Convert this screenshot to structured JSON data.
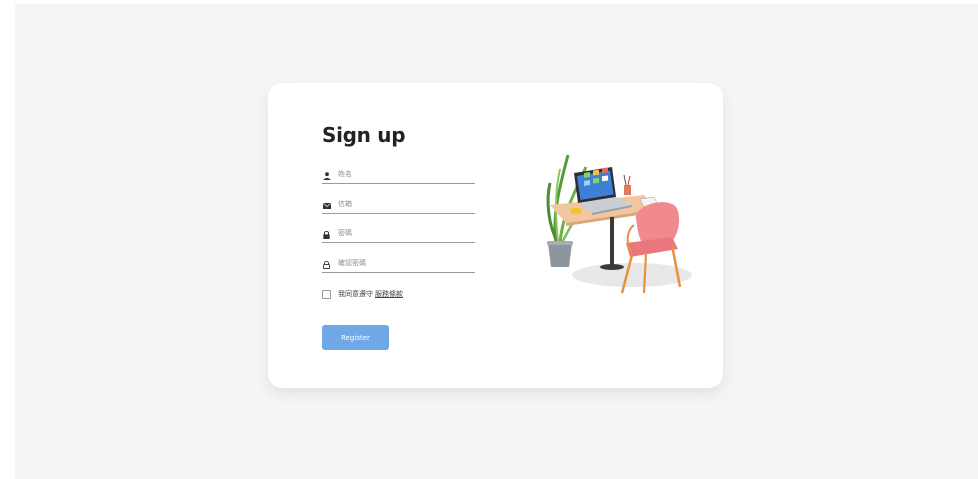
{
  "form": {
    "title": "Sign up",
    "name_placeholder": "姓名",
    "email_placeholder": "信箱",
    "password_placeholder": "密碼",
    "confirm_placeholder": "確認密碼",
    "agree_text": "我同意遵守",
    "agree_link": "服務條款",
    "register_label": "Register"
  },
  "icons": {
    "name": "user-icon",
    "email": "envelope-icon",
    "password": "lock-icon",
    "confirm": "lock-outline-icon",
    "illustration": "desk-laptop-illustration"
  },
  "colors": {
    "page_bg": "#f5f5f5",
    "card_bg": "#ffffff",
    "button_bg": "#6ea8e6",
    "title": "#222222"
  }
}
